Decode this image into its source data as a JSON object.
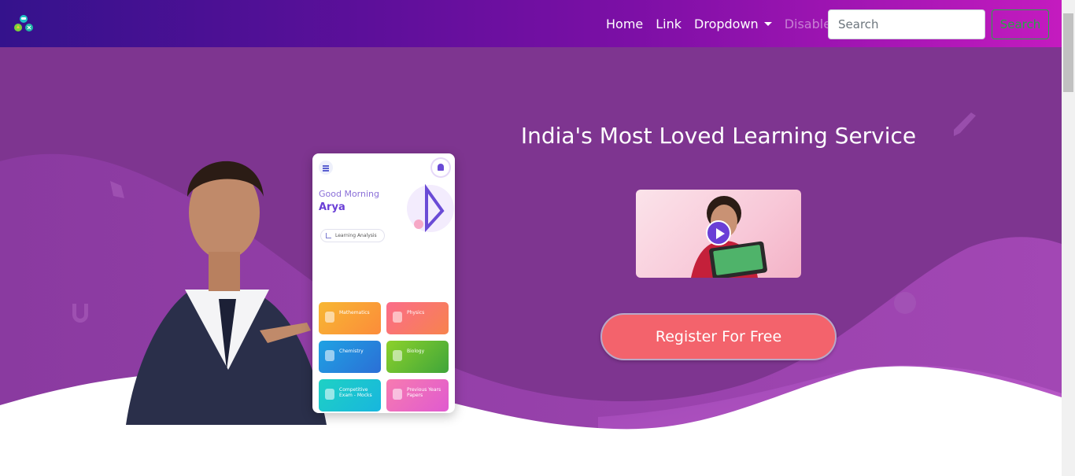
{
  "navbar": {
    "logo_icon": "brand-logo-icon",
    "links": [
      {
        "label": "Home",
        "disabled": false
      },
      {
        "label": "Link",
        "disabled": false
      },
      {
        "label": "Dropdown",
        "disabled": false
      },
      {
        "label": "Disabled",
        "disabled": true
      }
    ],
    "search_placeholder": "Search",
    "search_button": "Search"
  },
  "hero": {
    "headline": "India's Most Loved Learning Service",
    "video_icon": "play-icon",
    "register_button": "Register For Free"
  },
  "phone": {
    "greeting": "Good Morning",
    "name": "Arya",
    "analysis_chip": "Learning Analysis",
    "tiles": [
      {
        "label": "Mathematics"
      },
      {
        "label": "Physics"
      },
      {
        "label": "Chemistry"
      },
      {
        "label": "Biology"
      },
      {
        "label": "Competitive Exam - Mocks"
      },
      {
        "label": "Previous Years Papers"
      }
    ]
  },
  "colors": {
    "nav_gradient_start": "#34128c",
    "nav_gradient_end": "#c41bbf",
    "hero_bg": "#7e3590",
    "register": "#f3636c",
    "search_outline": "#28a745"
  }
}
